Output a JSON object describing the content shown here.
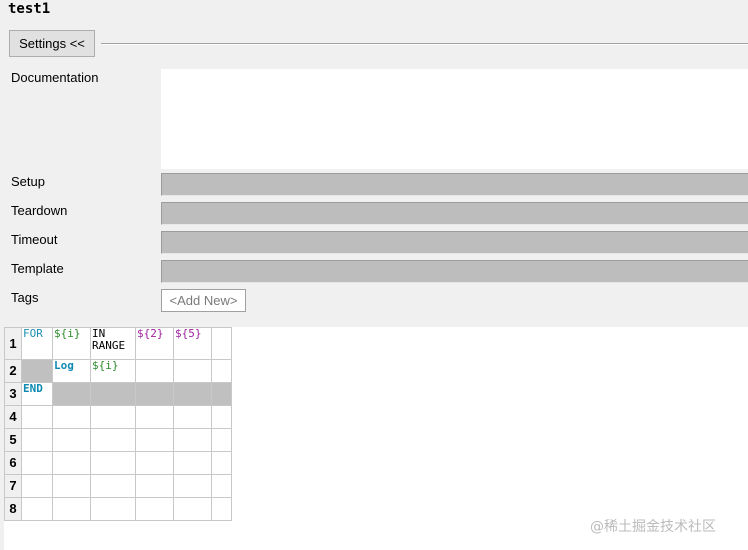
{
  "title": "test1",
  "settings_button": "Settings <<",
  "fields": {
    "documentation": "Documentation",
    "setup": "Setup",
    "teardown": "Teardown",
    "timeout": "Timeout",
    "template": "Template",
    "tags": "Tags",
    "add_new": "<Add New>"
  },
  "grid": {
    "row_numbers": [
      "1",
      "2",
      "3",
      "4",
      "5",
      "6",
      "7",
      "8"
    ],
    "rows": [
      [
        "FOR",
        "${i}",
        "IN\nRANGE",
        "${2}",
        "${5}",
        ""
      ],
      [
        "",
        "Log",
        "${i}",
        "",
        "",
        ""
      ],
      [
        "END",
        "",
        "",
        "",
        "",
        ""
      ],
      [
        "",
        "",
        "",
        "",
        "",
        ""
      ],
      [
        "",
        "",
        "",
        "",
        "",
        ""
      ],
      [
        "",
        "",
        "",
        "",
        "",
        ""
      ],
      [
        "",
        "",
        "",
        "",
        "",
        ""
      ],
      [
        "",
        "",
        "",
        "",
        "",
        ""
      ]
    ]
  },
  "watermark": "@稀土掘金技术社区"
}
